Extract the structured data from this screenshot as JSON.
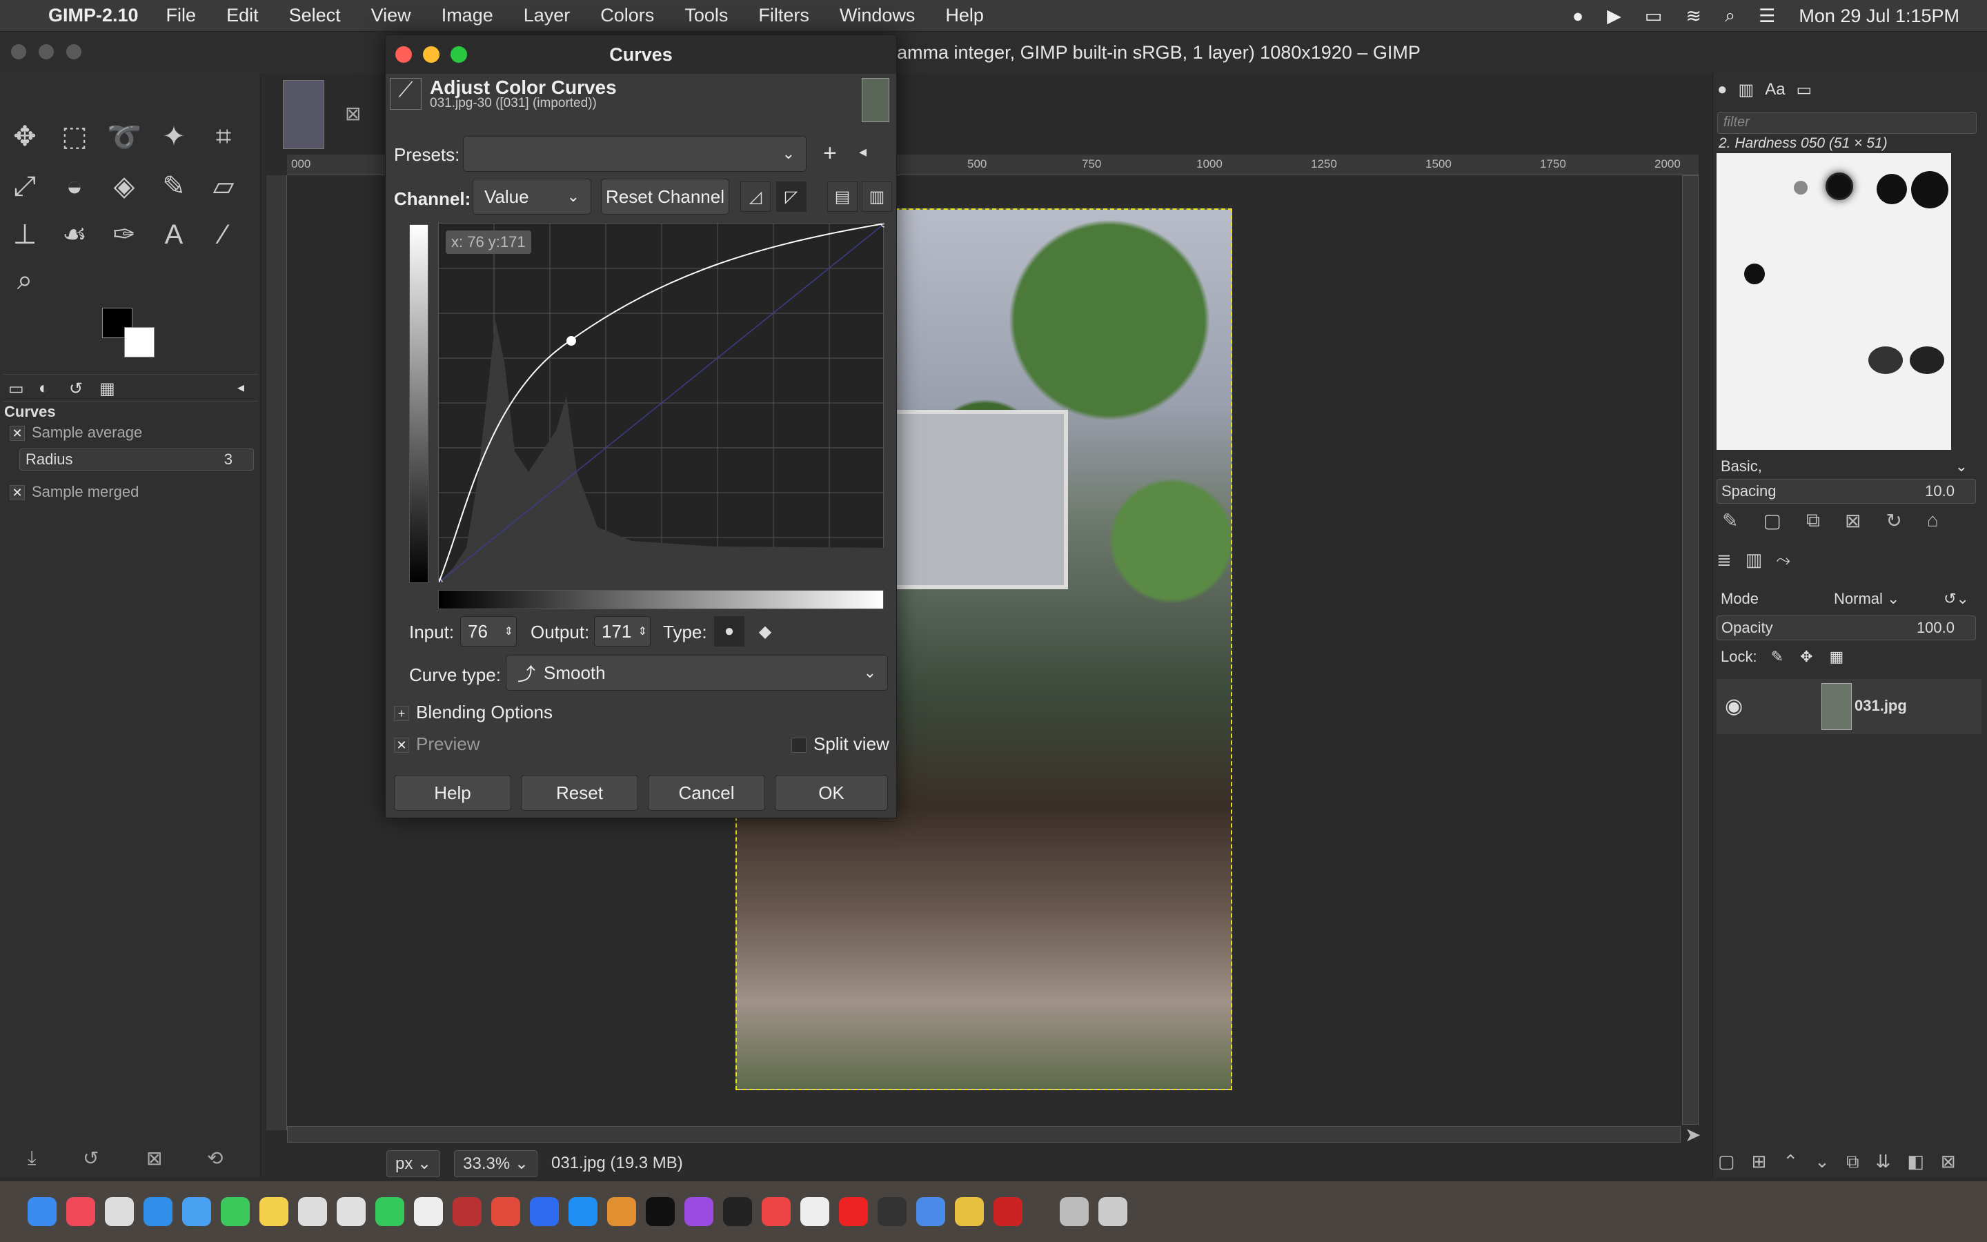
{
  "menubar": {
    "app": "GIMP-2.10",
    "items": [
      "File",
      "Edit",
      "Select",
      "View",
      "Image",
      "Layer",
      "Colors",
      "Tools",
      "Filters",
      "Windows",
      "Help"
    ],
    "datetime": "Mon 29 Jul  1:15PM"
  },
  "window": {
    "title": "amma integer, GIMP built-in sRGB, 1 layer) 1080x1920 – GIMP"
  },
  "tool_options": {
    "title": "Curves",
    "sample_average": "Sample average",
    "radius_label": "Radius",
    "radius_value": "3",
    "sample_merged": "Sample merged"
  },
  "ruler": {
    "ticks": [
      "000",
      "500",
      "750",
      "1000",
      "1250",
      "1500",
      "1750",
      "2000"
    ]
  },
  "status": {
    "unit": "px",
    "zoom": "33.3%",
    "file": "031.jpg (19.3 MB)"
  },
  "brushes": {
    "filter_placeholder": "filter",
    "current": "2. Hardness 050 (51 × 51)",
    "tag": "Basic,",
    "spacing_label": "Spacing",
    "spacing_value": "10.0"
  },
  "layers": {
    "mode_label": "Mode",
    "mode_value": "Normal",
    "opacity_label": "Opacity",
    "opacity_value": "100.0",
    "lock_label": "Lock:",
    "layer_name": "031.jpg"
  },
  "dialog": {
    "title": "Curves",
    "header": "Adjust Color Curves",
    "subheader": "031.jpg-30 ([031] (imported))",
    "presets_label": "Presets:",
    "presets_value": "",
    "channel_label": "Channel:",
    "channel_value": "Value",
    "reset_channel": "Reset Channel",
    "coord_readout": "x: 76 y:171",
    "input_label": "Input:",
    "input_value": "76",
    "output_label": "Output:",
    "output_value": "171",
    "type_label": "Type:",
    "curve_type_label": "Curve type:",
    "curve_type_value": "Smooth",
    "blending_options": "Blending Options",
    "preview": "Preview",
    "split_view": "Split view",
    "help": "Help",
    "reset": "Reset",
    "cancel": "Cancel",
    "ok": "OK"
  },
  "colors": {
    "accent": "#e8e020",
    "dialog_bg": "#3a3a3a",
    "curve": "#ffffff"
  }
}
